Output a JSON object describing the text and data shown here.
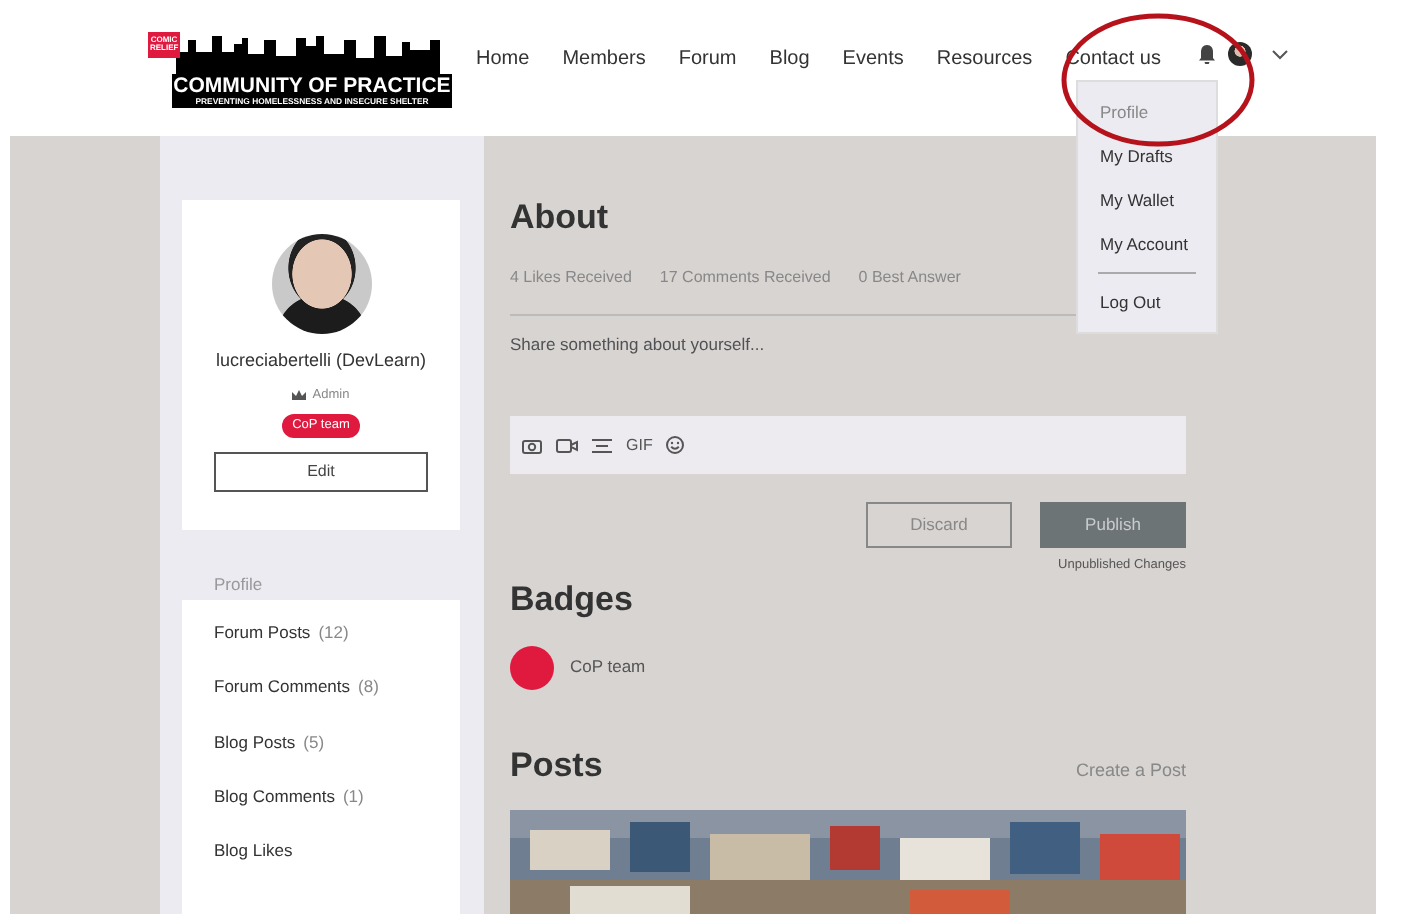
{
  "header": {
    "logo": {
      "badge": "COMIC RELIEF",
      "title": "COMMUNITY OF PRACTICE",
      "subtitle": "PREVENTING HOMELESSNESS AND INSECURE SHELTER"
    },
    "nav": [
      {
        "label": "Home"
      },
      {
        "label": "Members"
      },
      {
        "label": "Forum"
      },
      {
        "label": "Blog"
      },
      {
        "label": "Events"
      },
      {
        "label": "Resources"
      },
      {
        "label": "Contact us"
      }
    ],
    "user_menu": {
      "expanded": true,
      "items": [
        {
          "kind": "link",
          "label": "Profile",
          "selected": true
        },
        {
          "kind": "link",
          "label": "My Drafts",
          "selected": false
        },
        {
          "kind": "link",
          "label": "My Wallet",
          "selected": false
        },
        {
          "kind": "link",
          "label": "My Account",
          "selected": false
        },
        {
          "kind": "separator"
        },
        {
          "kind": "link",
          "label": "Log Out",
          "selected": false
        }
      ]
    }
  },
  "profile": {
    "name": "lucreciabertelli (DevLearn)",
    "role": "Admin",
    "badge": "CoP team",
    "edit_button": "Edit"
  },
  "sidebar": {
    "heading": "Profile",
    "items": [
      {
        "label": "Forum Posts",
        "count": "(12)"
      },
      {
        "label": "Forum Comments",
        "count": "(8)"
      },
      {
        "label": "Blog Posts",
        "count": "(5)"
      },
      {
        "label": "Blog Comments",
        "count": "(1)"
      },
      {
        "label": "Blog Likes"
      }
    ]
  },
  "about": {
    "title": "About",
    "stats": [
      "4 Likes Received",
      "17 Comments Received",
      "0 Best Answer"
    ],
    "editor": {
      "placeholder": "Share something about yourself...",
      "toolbar": [
        {
          "kind": "camera"
        },
        {
          "kind": "video"
        },
        {
          "kind": "divider"
        },
        {
          "kind": "gif",
          "label": "GIF"
        },
        {
          "kind": "emoji"
        }
      ]
    },
    "discard_button": "Discard",
    "publish_button": "Publish",
    "status": "Unpublished Changes"
  },
  "badges": {
    "title": "Badges",
    "items": [
      {
        "name": "CoP team",
        "color": "#e0193f"
      }
    ]
  },
  "posts": {
    "title": "Posts",
    "create_link": "Create a Post"
  }
}
